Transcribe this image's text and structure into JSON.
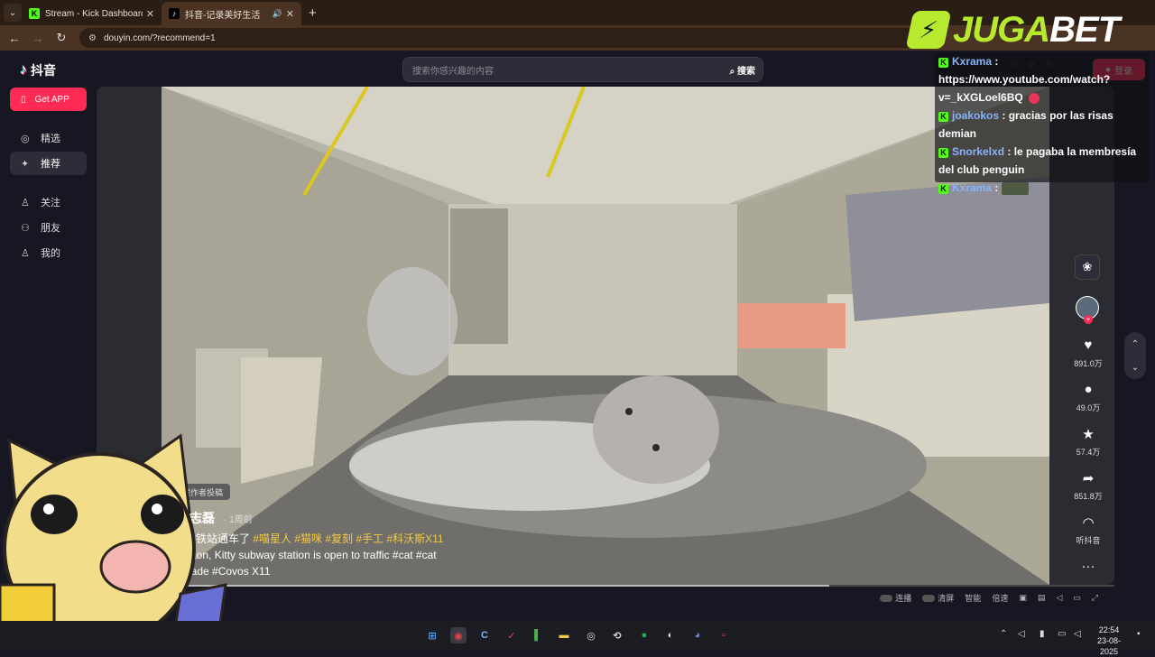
{
  "browser": {
    "tabs": [
      {
        "title": "Stream - Kick Dashboard",
        "favicon": "kick-icon",
        "active": false
      },
      {
        "title": "抖音-记录美好生活",
        "favicon": "tiktok-icon",
        "active": true
      }
    ],
    "address": "douyin.com/?recommend=1"
  },
  "overlay_brand": {
    "part1": "JUGA",
    "part2": "BET"
  },
  "douyin": {
    "logo": "抖音",
    "get_app": "Get APP",
    "sidebar": [
      {
        "label": "精选",
        "icon": "compass-icon"
      },
      {
        "label": "推荐",
        "icon": "sparkle-icon",
        "active": true
      },
      {
        "label": "关注",
        "icon": "follow-icon"
      },
      {
        "label": "朋友",
        "icon": "friends-icon"
      },
      {
        "label": "我的",
        "icon": "profile-icon"
      }
    ],
    "search_placeholder": "搜索你感兴趣的内容",
    "search_button": "搜索",
    "login": "登录"
  },
  "video": {
    "shelf_badge": "宝藏作者投稿",
    "author": "邓志磊",
    "time": "· 1周前",
    "desc_line1_text": "地铁站通车了",
    "desc_line1_tags": "#喵星人 #猫咪 #复刻 #手工 #科沃斯X11",
    "desc_line2": "ation, Kitty subway station is open to traffic #cat #cat",
    "desc_line3": "nade #Covos X11",
    "progress": 0.72
  },
  "actions": [
    {
      "icon": "heart-icon",
      "label": "891.0万"
    },
    {
      "icon": "comment-icon",
      "label": "49.0万"
    },
    {
      "icon": "star-icon",
      "label": "57.4万"
    },
    {
      "icon": "share-icon",
      "label": "851.8万"
    },
    {
      "icon": "headphones-icon",
      "label": "听抖音"
    },
    {
      "icon": "more-icon",
      "label": "···"
    }
  ],
  "controls": [
    "连播",
    "清屏",
    "智能",
    "倍速"
  ],
  "chat": [
    {
      "user": "Kxrama",
      "text": "https://www.youtube.com/watch?v=_kXGLoel6BQ"
    },
    {
      "user": "joakokos",
      "text": "gracias por las risas demian"
    },
    {
      "user": "Snorkelxd",
      "text": "le pagaba la membresía del club penguin"
    },
    {
      "user": "Kxrama",
      "text": ""
    }
  ],
  "clock": {
    "time": "22:54",
    "date": "23-08-2025"
  }
}
